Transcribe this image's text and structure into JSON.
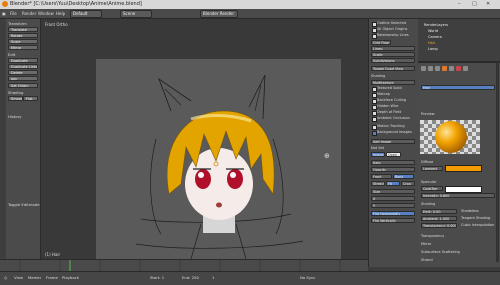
{
  "titlebar": {
    "title": "Blender* [C:\\Users\\Yuu\\Desktop\\Anime\\Anime.blend]",
    "minimize": "–",
    "maximize": "□",
    "close": "✕"
  },
  "menubar": {
    "items": [
      "File",
      "Render",
      "Window",
      "Help"
    ],
    "layout": "Default",
    "scene": "Scene",
    "engine": "Blender Render"
  },
  "toolshelf": {
    "transform_label": "Transform",
    "transform": [
      "Translate",
      "Rotate",
      "Scale",
      "Mirror"
    ],
    "edit_label": "Edit",
    "edit": [
      "Duplicate",
      "Duplicate Linked",
      "Delete",
      "Join"
    ],
    "set_origin": "Set Origin",
    "shading_label": "Shading",
    "shading": [
      "Smooth",
      "Flat"
    ],
    "history_label": "History",
    "toggle_operator": "Toggle Editmode"
  },
  "viewport": {
    "label": "Front Ortho",
    "footer": "(1) Hair",
    "cursor": "⊕"
  },
  "npanel": {
    "rows": [
      "Outline Selected",
      "All Object Origins",
      "Relationship Lines",
      "Grid Floor",
      "Lines:",
      "Scale:",
      "Subdivisions:",
      "Toggle Quad View",
      "Shading",
      "Multitexture",
      "Textured Solid",
      "Matcap",
      "Backface Culling",
      "Hidden Wire",
      "Depth of Field",
      "Ambient Occlusion",
      "Motion Tracking",
      "Background Images",
      "Add Image",
      "Not Set",
      "Image",
      "Open",
      "Axis:",
      "Opacity",
      "Front",
      "Back",
      "Stretch",
      "Fit",
      "Crop",
      "Size",
      "X",
      "Y",
      "Flip Horizontally",
      "Flip Vertically"
    ]
  },
  "outliner": {
    "items": [
      "RenderLayers",
      "World",
      "Camera",
      "Hair",
      "Lamp"
    ]
  },
  "props": {
    "material": "Hair",
    "surface": "Preview",
    "diffuse": "Diffuse",
    "lambert": "Lambert",
    "specular": "Specular",
    "cooktorr": "CookTorr",
    "intensity": "Intensity: 0.800",
    "shading": "Shading",
    "emit": "Emit: 0.00",
    "ambient": "Ambient: 1.000",
    "translucency": "Translucency: 0.000",
    "shadeless": "Shadeless",
    "tangent": "Tangent Shading",
    "cubic": "Cubic Interpolation",
    "transparency": "Transparency",
    "mirror": "Mirror",
    "sss": "Subsurface Scattering",
    "strand": "Strand"
  },
  "statusbar": {
    "items": [
      "View",
      "Marker",
      "Frame",
      "Playback"
    ],
    "start": "Start: 1",
    "end": "End: 250",
    "frame": "1",
    "sync": "No Sync"
  },
  "colors": {
    "accent_orange": "#f39b00",
    "selection_blue": "#5680c2",
    "bg": "#3c3c3c"
  }
}
